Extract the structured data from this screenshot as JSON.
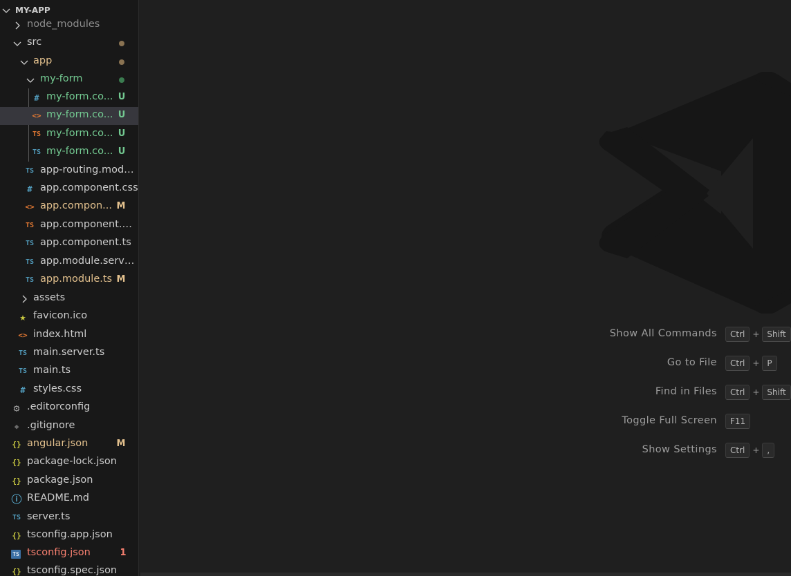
{
  "explorer": {
    "project_title": "MY-APP",
    "items": [
      {
        "label": "node_modules",
        "icon": "chevron-right-icon",
        "decoration": "",
        "dot": ""
      },
      {
        "label": "src",
        "icon": "chevron-down-icon",
        "decoration": "",
        "dot": "#8a7352"
      },
      {
        "label": "app",
        "icon": "chevron-down-icon",
        "decoration": "",
        "dot": "#8a7352"
      },
      {
        "label": "my-form",
        "icon": "chevron-down-icon",
        "decoration": "",
        "dot": "#3b7c50"
      },
      {
        "label": "my-form.co...",
        "icon": "css-file-icon",
        "glyph": "#",
        "decoration": "U"
      },
      {
        "label": "my-form.co...",
        "icon": "html-file-icon",
        "glyph": "<>",
        "decoration": "U"
      },
      {
        "label": "my-form.co...",
        "icon": "ts-spec-file-icon",
        "glyph": "TS",
        "decoration": "U"
      },
      {
        "label": "my-form.co...",
        "icon": "ts-file-icon",
        "glyph": "TS",
        "decoration": "U"
      },
      {
        "label": "app-routing.modu...",
        "icon": "ts-file-icon",
        "glyph": "TS",
        "decoration": ""
      },
      {
        "label": "app.component.css",
        "icon": "css-file-icon",
        "glyph": "#",
        "decoration": ""
      },
      {
        "label": "app.compon...",
        "icon": "html-file-icon",
        "glyph": "<>",
        "decoration": "M"
      },
      {
        "label": "app.component.s...",
        "icon": "ts-spec-file-icon",
        "glyph": "TS",
        "decoration": ""
      },
      {
        "label": "app.component.ts",
        "icon": "ts-file-icon",
        "glyph": "TS",
        "decoration": ""
      },
      {
        "label": "app.module.serve...",
        "icon": "ts-file-icon",
        "glyph": "TS",
        "decoration": ""
      },
      {
        "label": "app.module.ts",
        "icon": "ts-file-icon",
        "glyph": "TS",
        "decoration": "M"
      },
      {
        "label": "assets",
        "icon": "chevron-right-icon",
        "decoration": ""
      },
      {
        "label": "favicon.ico",
        "icon": "star-icon",
        "glyph": "★",
        "decoration": ""
      },
      {
        "label": "index.html",
        "icon": "html-file-icon",
        "glyph": "<>",
        "decoration": ""
      },
      {
        "label": "main.server.ts",
        "icon": "ts-file-icon",
        "glyph": "TS",
        "decoration": ""
      },
      {
        "label": "main.ts",
        "icon": "ts-file-icon",
        "glyph": "TS",
        "decoration": ""
      },
      {
        "label": "styles.css",
        "icon": "css-file-icon",
        "glyph": "#",
        "decoration": ""
      },
      {
        "label": ".editorconfig",
        "icon": "gear-icon",
        "glyph": "⚙",
        "decoration": ""
      },
      {
        "label": ".gitignore",
        "icon": "git-icon",
        "glyph": "◆",
        "decoration": ""
      },
      {
        "label": "angular.json",
        "icon": "json-file-icon",
        "glyph": "{}",
        "decoration": "M"
      },
      {
        "label": "package-lock.json",
        "icon": "json-file-icon",
        "glyph": "{}",
        "decoration": ""
      },
      {
        "label": "package.json",
        "icon": "json-file-icon",
        "glyph": "{}",
        "decoration": ""
      },
      {
        "label": "README.md",
        "icon": "info-icon",
        "glyph": "ⓘ",
        "decoration": ""
      },
      {
        "label": "server.ts",
        "icon": "ts-file-icon",
        "glyph": "TS",
        "decoration": ""
      },
      {
        "label": "tsconfig.app.json",
        "icon": "json-file-icon",
        "glyph": "{}",
        "decoration": ""
      },
      {
        "label": "tsconfig.json",
        "icon": "tsconfig-file-icon",
        "glyph": "TS",
        "decoration": "1"
      },
      {
        "label": "tsconfig.spec.json",
        "icon": "json-file-icon",
        "glyph": "{}",
        "decoration": ""
      }
    ]
  },
  "editor": {
    "shortcuts": [
      {
        "label": "Show All Commands",
        "keys": [
          "Ctrl",
          "Shift"
        ]
      },
      {
        "label": "Go to File",
        "keys": [
          "Ctrl",
          "P"
        ]
      },
      {
        "label": "Find in Files",
        "keys": [
          "Ctrl",
          "Shift"
        ]
      },
      {
        "label": "Toggle Full Screen",
        "keys": [
          "F11"
        ]
      },
      {
        "label": "Show Settings",
        "keys": [
          "Ctrl",
          ","
        ]
      }
    ]
  },
  "colors": {
    "untracked": "#73c991",
    "modified": "#e2c08d",
    "error": "#f88070",
    "selection": "#37373d"
  }
}
